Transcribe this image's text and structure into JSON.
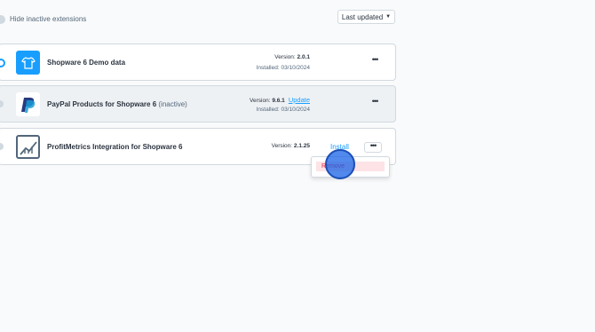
{
  "filter": {
    "hide_inactive_label": "Hide inactive extensions"
  },
  "sort": {
    "label": "Last updated"
  },
  "extensions": [
    {
      "name": "Shopware 6 Demo data",
      "version_label": "Version:",
      "version": "2.0.1",
      "installed_label": "Installed:",
      "installed_date": "03/10/2024",
      "icon": "tshirt-icon",
      "active": true
    },
    {
      "name": "PayPal Products for Shopware 6",
      "status": "(inactive)",
      "version_label": "Version:",
      "version": "9.6.1",
      "update_label": "Update",
      "installed_label": "Installed:",
      "installed_date": "03/10/2024",
      "icon": "paypal-logo-icon",
      "active": false
    },
    {
      "name": "ProfitMetrics Integration for Shopware 6",
      "version_label": "Version:",
      "version": "2.1.25",
      "install_label": "Install",
      "icon": "chart-logo-icon",
      "active": false
    }
  ],
  "context_menu": {
    "remove_label": "Remove"
  },
  "colors": {
    "accent": "#189eff",
    "danger": "#de294c",
    "danger_bg": "#fde3e6"
  }
}
